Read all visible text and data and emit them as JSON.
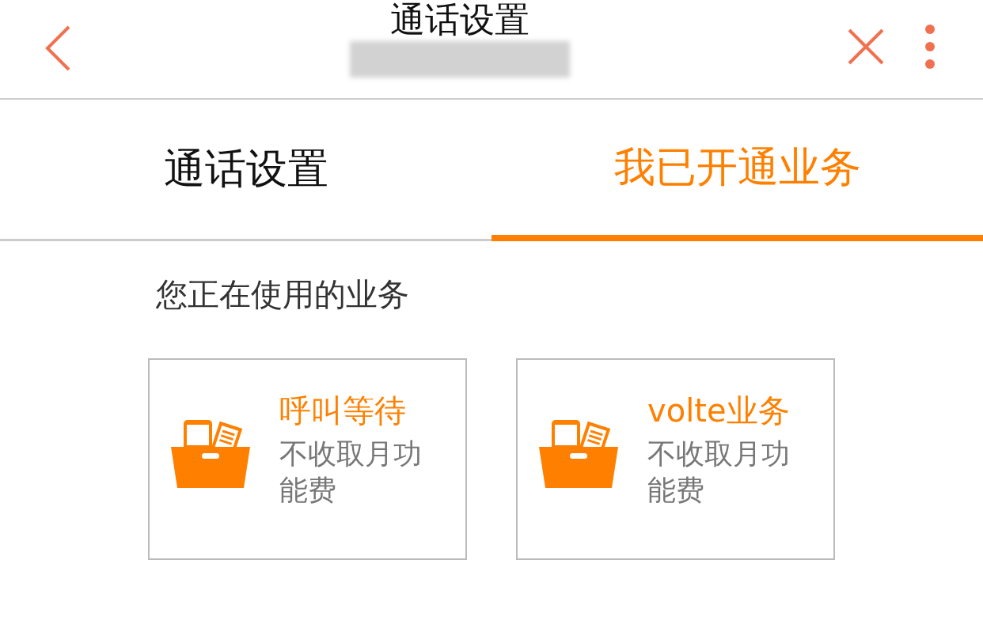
{
  "header": {
    "title": "通话设置"
  },
  "tabs": [
    {
      "label": "通话设置",
      "selected": false
    },
    {
      "label": "我已开通业务",
      "selected": true
    }
  ],
  "section": {
    "title": "您正在使用的业务"
  },
  "services": [
    {
      "name": "呼叫等待",
      "description": "不收取月功能费"
    },
    {
      "name": "volte业务",
      "description": "不收取月功能费"
    }
  ]
}
